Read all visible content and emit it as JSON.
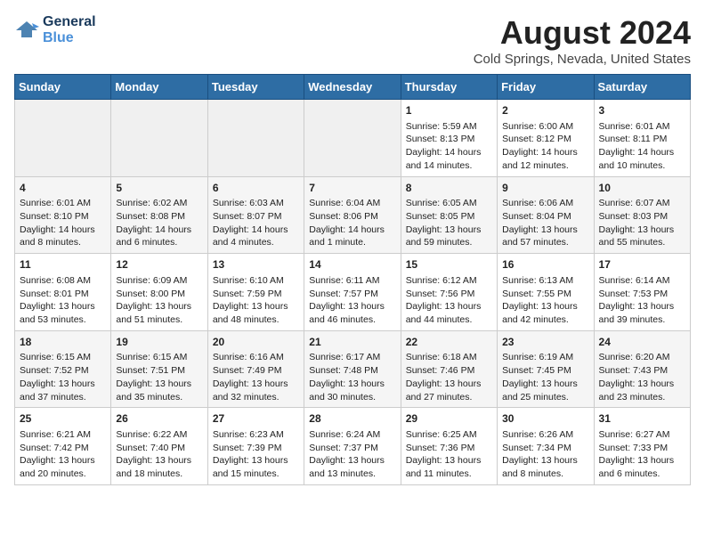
{
  "header": {
    "logo_line1": "General",
    "logo_line2": "Blue",
    "title": "August 2024",
    "subtitle": "Cold Springs, Nevada, United States"
  },
  "weekdays": [
    "Sunday",
    "Monday",
    "Tuesday",
    "Wednesday",
    "Thursday",
    "Friday",
    "Saturday"
  ],
  "weeks": [
    [
      {
        "day": "",
        "info": ""
      },
      {
        "day": "",
        "info": ""
      },
      {
        "day": "",
        "info": ""
      },
      {
        "day": "",
        "info": ""
      },
      {
        "day": "1",
        "info": "Sunrise: 5:59 AM\nSunset: 8:13 PM\nDaylight: 14 hours and 14 minutes."
      },
      {
        "day": "2",
        "info": "Sunrise: 6:00 AM\nSunset: 8:12 PM\nDaylight: 14 hours and 12 minutes."
      },
      {
        "day": "3",
        "info": "Sunrise: 6:01 AM\nSunset: 8:11 PM\nDaylight: 14 hours and 10 minutes."
      }
    ],
    [
      {
        "day": "4",
        "info": "Sunrise: 6:01 AM\nSunset: 8:10 PM\nDaylight: 14 hours and 8 minutes."
      },
      {
        "day": "5",
        "info": "Sunrise: 6:02 AM\nSunset: 8:08 PM\nDaylight: 14 hours and 6 minutes."
      },
      {
        "day": "6",
        "info": "Sunrise: 6:03 AM\nSunset: 8:07 PM\nDaylight: 14 hours and 4 minutes."
      },
      {
        "day": "7",
        "info": "Sunrise: 6:04 AM\nSunset: 8:06 PM\nDaylight: 14 hours and 1 minute."
      },
      {
        "day": "8",
        "info": "Sunrise: 6:05 AM\nSunset: 8:05 PM\nDaylight: 13 hours and 59 minutes."
      },
      {
        "day": "9",
        "info": "Sunrise: 6:06 AM\nSunset: 8:04 PM\nDaylight: 13 hours and 57 minutes."
      },
      {
        "day": "10",
        "info": "Sunrise: 6:07 AM\nSunset: 8:03 PM\nDaylight: 13 hours and 55 minutes."
      }
    ],
    [
      {
        "day": "11",
        "info": "Sunrise: 6:08 AM\nSunset: 8:01 PM\nDaylight: 13 hours and 53 minutes."
      },
      {
        "day": "12",
        "info": "Sunrise: 6:09 AM\nSunset: 8:00 PM\nDaylight: 13 hours and 51 minutes."
      },
      {
        "day": "13",
        "info": "Sunrise: 6:10 AM\nSunset: 7:59 PM\nDaylight: 13 hours and 48 minutes."
      },
      {
        "day": "14",
        "info": "Sunrise: 6:11 AM\nSunset: 7:57 PM\nDaylight: 13 hours and 46 minutes."
      },
      {
        "day": "15",
        "info": "Sunrise: 6:12 AM\nSunset: 7:56 PM\nDaylight: 13 hours and 44 minutes."
      },
      {
        "day": "16",
        "info": "Sunrise: 6:13 AM\nSunset: 7:55 PM\nDaylight: 13 hours and 42 minutes."
      },
      {
        "day": "17",
        "info": "Sunrise: 6:14 AM\nSunset: 7:53 PM\nDaylight: 13 hours and 39 minutes."
      }
    ],
    [
      {
        "day": "18",
        "info": "Sunrise: 6:15 AM\nSunset: 7:52 PM\nDaylight: 13 hours and 37 minutes."
      },
      {
        "day": "19",
        "info": "Sunrise: 6:15 AM\nSunset: 7:51 PM\nDaylight: 13 hours and 35 minutes."
      },
      {
        "day": "20",
        "info": "Sunrise: 6:16 AM\nSunset: 7:49 PM\nDaylight: 13 hours and 32 minutes."
      },
      {
        "day": "21",
        "info": "Sunrise: 6:17 AM\nSunset: 7:48 PM\nDaylight: 13 hours and 30 minutes."
      },
      {
        "day": "22",
        "info": "Sunrise: 6:18 AM\nSunset: 7:46 PM\nDaylight: 13 hours and 27 minutes."
      },
      {
        "day": "23",
        "info": "Sunrise: 6:19 AM\nSunset: 7:45 PM\nDaylight: 13 hours and 25 minutes."
      },
      {
        "day": "24",
        "info": "Sunrise: 6:20 AM\nSunset: 7:43 PM\nDaylight: 13 hours and 23 minutes."
      }
    ],
    [
      {
        "day": "25",
        "info": "Sunrise: 6:21 AM\nSunset: 7:42 PM\nDaylight: 13 hours and 20 minutes."
      },
      {
        "day": "26",
        "info": "Sunrise: 6:22 AM\nSunset: 7:40 PM\nDaylight: 13 hours and 18 minutes."
      },
      {
        "day": "27",
        "info": "Sunrise: 6:23 AM\nSunset: 7:39 PM\nDaylight: 13 hours and 15 minutes."
      },
      {
        "day": "28",
        "info": "Sunrise: 6:24 AM\nSunset: 7:37 PM\nDaylight: 13 hours and 13 minutes."
      },
      {
        "day": "29",
        "info": "Sunrise: 6:25 AM\nSunset: 7:36 PM\nDaylight: 13 hours and 11 minutes."
      },
      {
        "day": "30",
        "info": "Sunrise: 6:26 AM\nSunset: 7:34 PM\nDaylight: 13 hours and 8 minutes."
      },
      {
        "day": "31",
        "info": "Sunrise: 6:27 AM\nSunset: 7:33 PM\nDaylight: 13 hours and 6 minutes."
      }
    ]
  ]
}
